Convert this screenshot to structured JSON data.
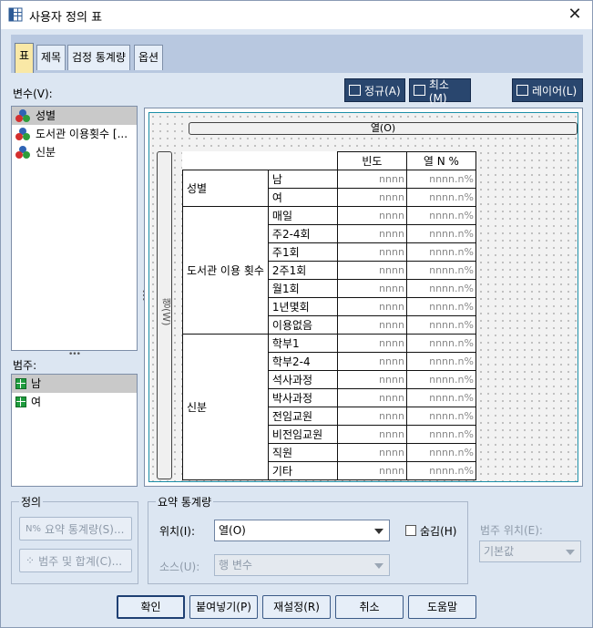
{
  "window": {
    "title": "사용자 정의 표",
    "close": "✕"
  },
  "tabs": [
    {
      "label": "표",
      "active": true
    },
    {
      "label": "제목"
    },
    {
      "label": "검정 통계량"
    },
    {
      "label": "옵션"
    }
  ],
  "variables": {
    "label": "변수(V):",
    "items": [
      "성별",
      "도서관 이용횟수 [...",
      "신분"
    ]
  },
  "categories": {
    "label": "범주:",
    "items": [
      "남",
      "여"
    ]
  },
  "toolbar": {
    "normal": "정규(A)",
    "compact": "최소(M)",
    "layers": "레이어(L)"
  },
  "canvas": {
    "column_bar": "열(O)",
    "row_bar": "행(W)",
    "header": [
      "빈도",
      "열 N %"
    ],
    "cell_count": "nnnn",
    "cell_pct": "nnnn.n%",
    "groups": [
      {
        "variable": "성별",
        "categories": [
          "남",
          "여"
        ]
      },
      {
        "variable": "도서관 이용 횟수",
        "categories": [
          "매일",
          "주2-4회",
          "주1회",
          "2주1회",
          "월1회",
          "1년몇회",
          "이용없음"
        ]
      },
      {
        "variable": "신분",
        "categories": [
          "학부1",
          "학부2-4",
          "석사과정",
          "박사과정",
          "전임교원",
          "비전임교원",
          "직원",
          "기타"
        ]
      }
    ]
  },
  "define": {
    "title": "정의",
    "summary_btn": "요약 통계량(S)...",
    "categories_btn": "범주 및 합계(C)..."
  },
  "summary": {
    "title": "요약 통계량",
    "position_label": "위치(I):",
    "position_value": "열(O)",
    "hide_label": "숨김(H)",
    "source_label": "소스(U):",
    "source_value": "행 변수"
  },
  "category_position": {
    "label": "범주 위치(E):",
    "value": "기본값"
  },
  "buttons": {
    "ok": "확인",
    "paste": "붙여넣기(P)",
    "reset": "재설정(R)",
    "cancel": "취소",
    "help": "도움말"
  },
  "colors": {
    "accent": "#29466e",
    "active_tab": "#f9e8a6",
    "background": "#dce6f2"
  }
}
